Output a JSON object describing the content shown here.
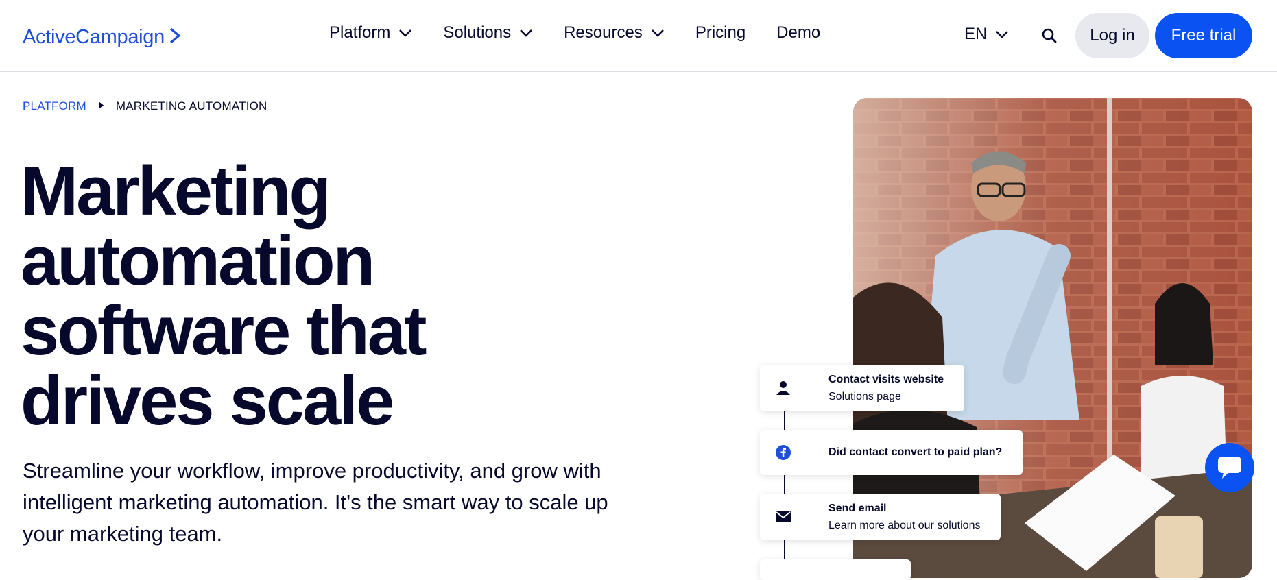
{
  "header": {
    "logo_text": "ActiveCampaign",
    "logo_chevron": ">",
    "nav": [
      {
        "label": "Platform",
        "dropdown": true
      },
      {
        "label": "Solutions",
        "dropdown": true
      },
      {
        "label": "Resources",
        "dropdown": true
      },
      {
        "label": "Pricing",
        "dropdown": false
      },
      {
        "label": "Demo",
        "dropdown": false
      }
    ],
    "language": "EN",
    "login_label": "Log in",
    "trial_label": "Free trial"
  },
  "breadcrumb": {
    "parent": "PLATFORM",
    "current": "MARKETING AUTOMATION"
  },
  "hero": {
    "title": "Marketing automation software that drives scale",
    "subtitle": "Streamline your workflow, improve productivity, and grow with intelligent marketing automation. It's the smart way to scale up your marketing team."
  },
  "workflow": [
    {
      "icon": "person-icon",
      "title": "Contact visits website",
      "detail": "Solutions page"
    },
    {
      "icon": "facebook-icon",
      "title": "Did contact convert to paid plan?",
      "detail": ""
    },
    {
      "icon": "mail-icon",
      "title": "Send email",
      "detail": "Learn more about our solutions"
    }
  ],
  "colors": {
    "brand_blue": "#0b52f2",
    "text_navy": "#06092b",
    "login_bg": "#e8e9ee"
  }
}
